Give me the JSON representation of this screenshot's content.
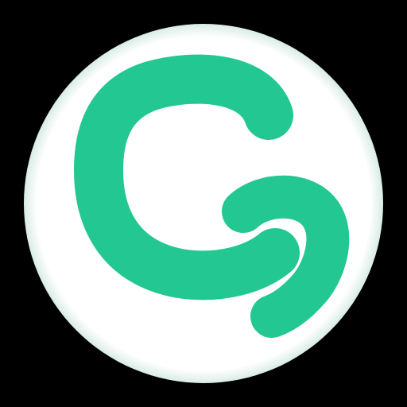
{
  "logo": {
    "icon_name": "app-logo-icon",
    "background_color": "#000000",
    "circle_color": "#ffffff",
    "rim_color": "#d9ece6",
    "mark_color": "#23c792"
  }
}
